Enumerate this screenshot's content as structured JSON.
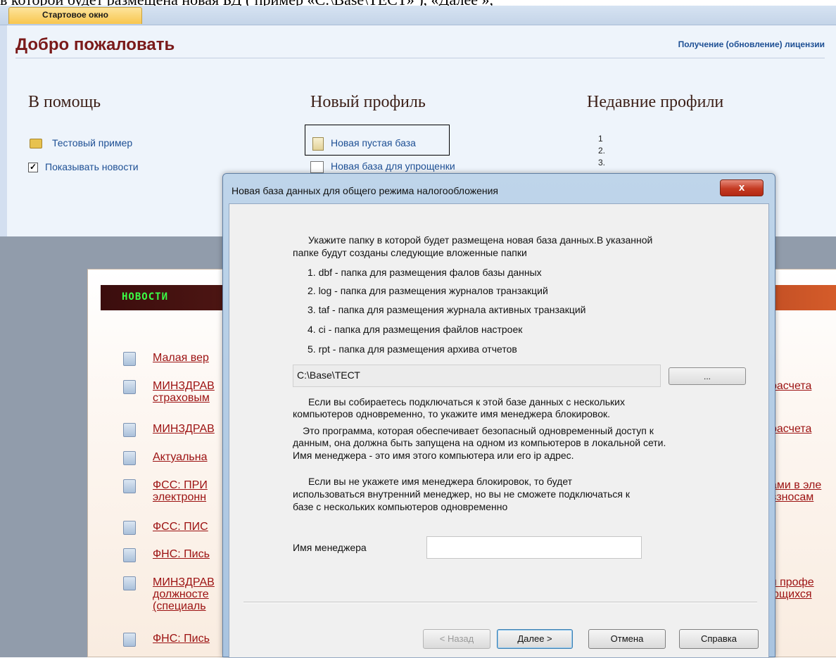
{
  "doc_caption": "в которой будет размещена новая БД ( пример «C:\\Base\\ТЕСТ» ), «Далее »,",
  "tab": {
    "label": "Стартовое окно"
  },
  "start": {
    "welcome": "Добро пожаловать",
    "license_link": "Получение (обновление) лицензии",
    "help": {
      "title": "В помощь",
      "test_example": "Тестовый пример",
      "show_news": "Показывать новости",
      "show_news_checked": true
    },
    "new_profile": {
      "title": "Новый профиль",
      "new_empty_db": "Новая пустая база",
      "new_simplified_db": "Новая база для упрощенки"
    },
    "recent": {
      "title": "Недавние профили",
      "items": [
        "1",
        "2.",
        "3."
      ]
    }
  },
  "news": {
    "title": "НОВОСТИ",
    "rows": [
      {
        "text": "Малая вер",
        "right": ""
      },
      {
        "text": "МИНЗДРАВ\nстраховым",
        "right": "расчета"
      },
      {
        "text": "МИНЗДРАВ",
        "right": "расчета"
      },
      {
        "text": "Актуальна",
        "right": ""
      },
      {
        "text": "ФСС: ПРИ\nэлектронн",
        "right": "ами в эле\nвзносам"
      },
      {
        "text": "ФСС: ПИС",
        "right": ""
      },
      {
        "text": "ФНС: Пись",
        "right": ""
      },
      {
        "text": "МИНЗДРАВ\nдолжносте\n(специаль",
        "right": "я профе\nющихся"
      },
      {
        "text": "ФНС: Пись",
        "right": ""
      }
    ]
  },
  "dialog": {
    "title": "Новая база данных для общего режима налогообложения",
    "close_label": "x",
    "intro_line1": "Укажите папку в которой будет размещена новая база данных.В указанной",
    "intro_line2": "папке будут созданы следующие вложенные папки",
    "folders": [
      "1. dbf - папка для размещения фалов базы данных",
      "2. log - папка для размещения журналов транзакций",
      "3. taf - папка для размещения журнала активных транзакций",
      "4. ci - папка для размещения файлов настроек",
      "5. rpt - папка для размещения архива отчетов"
    ],
    "path_value": "C:\\Base\\ТЕСТ",
    "browse_label": "...",
    "para1_line1": "Если вы собираетесь подключаться к этой базе данных с нескольких",
    "para1_line2": "компьютеров одновременно, то укажите имя менеджера блокировок.",
    "para2_line1": "Это программа, которая обеспечивает безопасный одновременный доступ к",
    "para2_line2": "данным, она должна быть запущена на одном из компьютеров в локальной сети.",
    "para2_line3": "Имя менеджера - это имя этого компьютера или его ip адрес.",
    "para3_line1": "Если вы не укажете имя менеджера блокировок, то будет",
    "para3_line2": "использоваться внутренний менеджер, но вы не сможете подключаться к",
    "para3_line3": "базе с нескольких компьютеров одновременно",
    "manager_label": "Имя менеджера",
    "manager_value": "",
    "buttons": {
      "back": "< Назад",
      "next": "Далее >",
      "cancel": "Отмена",
      "help": "Справка"
    }
  }
}
